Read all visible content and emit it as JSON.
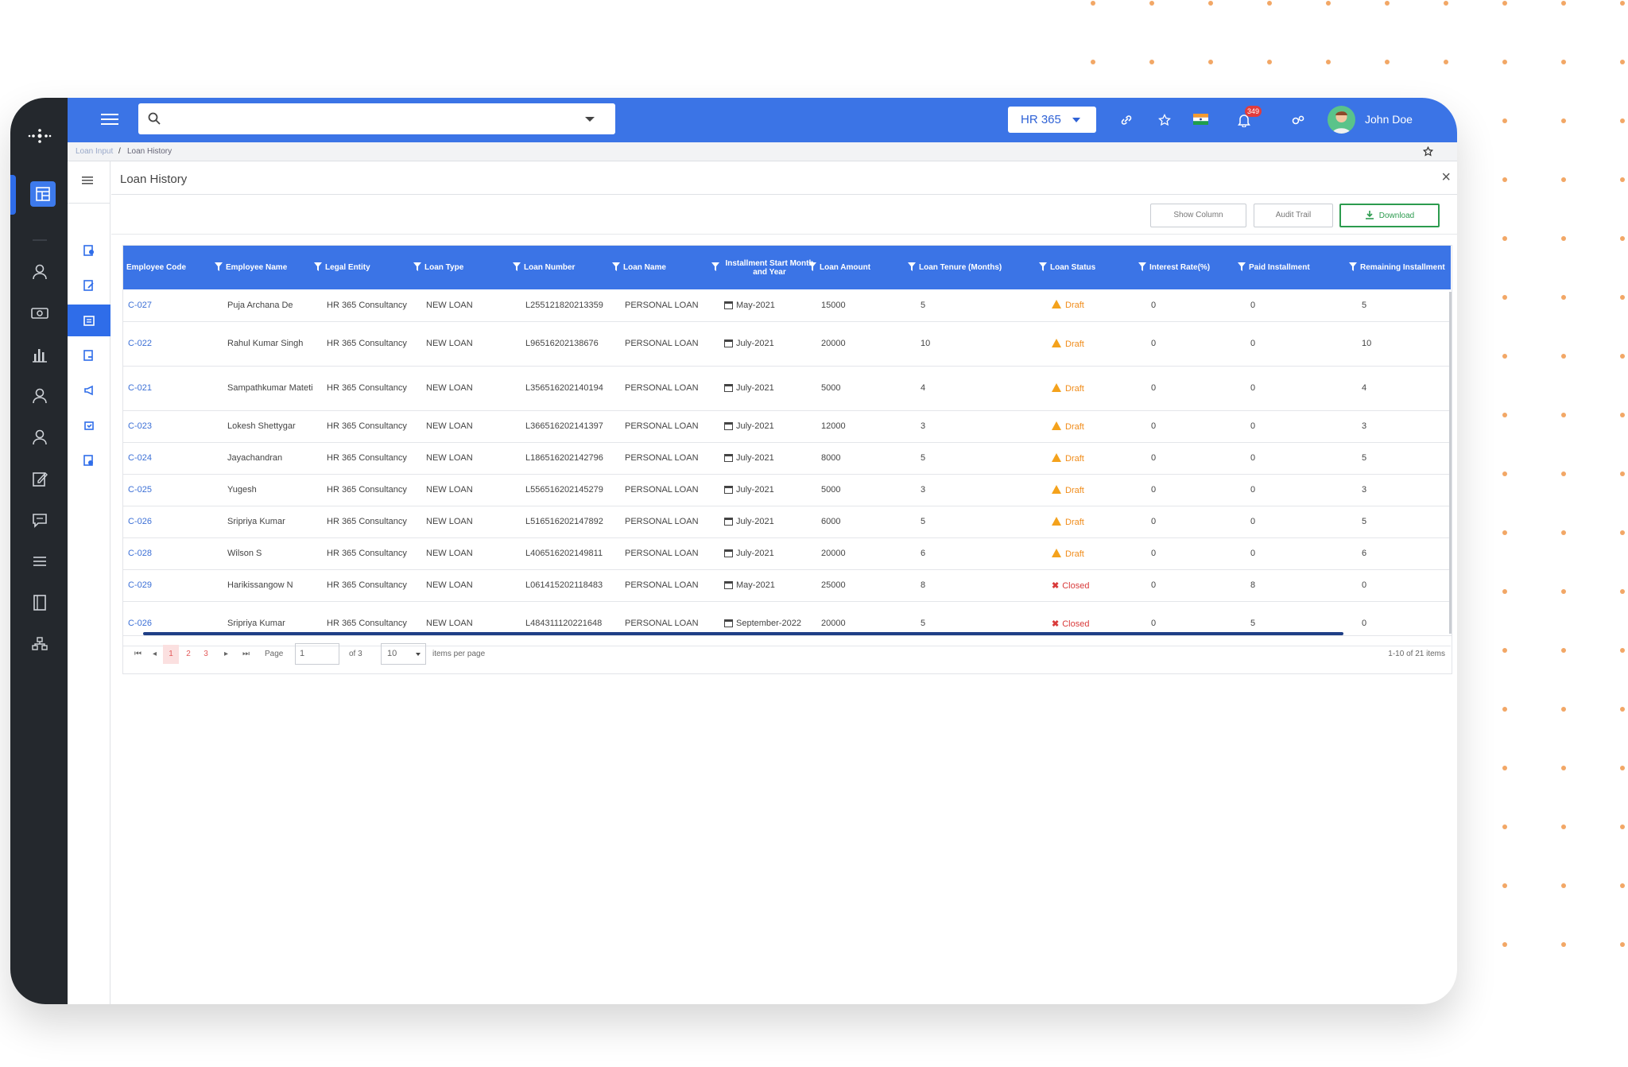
{
  "search": {
    "placeholder": ""
  },
  "header": {
    "module_selector": "HR 365",
    "notification_count": "349",
    "user_name": "John Doe"
  },
  "breadcrumb": {
    "parent": "Loan Input",
    "separator": "/",
    "current": "Loan History"
  },
  "page": {
    "title": "Loan History",
    "close": "×"
  },
  "toolbar": {
    "show_column": "Show Column",
    "audit_trail": "Audit Trail",
    "download": "Download"
  },
  "table": {
    "columns": [
      "Employee Code",
      "Employee Name",
      "Legal Entity",
      "Loan Type",
      "Loan Number",
      "Loan Name",
      "Installment Start Month and Year",
      "Loan Amount",
      "Loan Tenure (Months)",
      "Loan Status",
      "Interest Rate(%)",
      "Paid Installment",
      "Remaining Installment"
    ],
    "rows": [
      {
        "code": "C-027",
        "name": "Puja Archana De",
        "entity": "HR 365 Consultancy",
        "type": "NEW LOAN",
        "number": "L255121820213359",
        "loan_name": "PERSONAL LOAN",
        "start": "May-2021",
        "amount": "15000",
        "tenure": "5",
        "status": "Draft",
        "rate": "0",
        "paid": "0",
        "remaining": "5"
      },
      {
        "code": "C-022",
        "name": "Rahul Kumar Singh",
        "entity": "HR 365 Consultancy",
        "type": "NEW LOAN",
        "number": "L96516202138676",
        "loan_name": "PERSONAL LOAN",
        "start": "July-2021",
        "amount": "20000",
        "tenure": "10",
        "status": "Draft",
        "rate": "0",
        "paid": "0",
        "remaining": "10"
      },
      {
        "code": "C-021",
        "name": "Sampathkumar Mateti",
        "entity": "HR 365 Consultancy",
        "type": "NEW LOAN",
        "number": "L356516202140194",
        "loan_name": "PERSONAL LOAN",
        "start": "July-2021",
        "amount": "5000",
        "tenure": "4",
        "status": "Draft",
        "rate": "0",
        "paid": "0",
        "remaining": "4"
      },
      {
        "code": "C-023",
        "name": "Lokesh Shettygar",
        "entity": "HR 365 Consultancy",
        "type": "NEW LOAN",
        "number": "L366516202141397",
        "loan_name": "PERSONAL LOAN",
        "start": "July-2021",
        "amount": "12000",
        "tenure": "3",
        "status": "Draft",
        "rate": "0",
        "paid": "0",
        "remaining": "3"
      },
      {
        "code": "C-024",
        "name": "Jayachandran",
        "entity": "HR 365 Consultancy",
        "type": "NEW LOAN",
        "number": "L186516202142796",
        "loan_name": "PERSONAL LOAN",
        "start": "July-2021",
        "amount": "8000",
        "tenure": "5",
        "status": "Draft",
        "rate": "0",
        "paid": "0",
        "remaining": "5"
      },
      {
        "code": "C-025",
        "name": "Yugesh",
        "entity": "HR 365 Consultancy",
        "type": "NEW LOAN",
        "number": "L556516202145279",
        "loan_name": "PERSONAL LOAN",
        "start": "July-2021",
        "amount": "5000",
        "tenure": "3",
        "status": "Draft",
        "rate": "0",
        "paid": "0",
        "remaining": "3"
      },
      {
        "code": "C-026",
        "name": "Sripriya Kumar",
        "entity": "HR 365 Consultancy",
        "type": "NEW LOAN",
        "number": "L516516202147892",
        "loan_name": "PERSONAL LOAN",
        "start": "July-2021",
        "amount": "6000",
        "tenure": "5",
        "status": "Draft",
        "rate": "0",
        "paid": "0",
        "remaining": "5"
      },
      {
        "code": "C-028",
        "name": "Wilson S",
        "entity": "HR 365 Consultancy",
        "type": "NEW LOAN",
        "number": "L406516202149811",
        "loan_name": "PERSONAL LOAN",
        "start": "July-2021",
        "amount": "20000",
        "tenure": "6",
        "status": "Draft",
        "rate": "0",
        "paid": "0",
        "remaining": "6"
      },
      {
        "code": "C-029",
        "name": "Harikissangow N",
        "entity": "HR 365 Consultancy",
        "type": "NEW LOAN",
        "number": "L061415202118483",
        "loan_name": "PERSONAL LOAN",
        "start": "May-2021",
        "amount": "25000",
        "tenure": "8",
        "status": "Closed",
        "rate": "0",
        "paid": "8",
        "remaining": "0"
      },
      {
        "code": "C-026",
        "name": "Sripriya Kumar",
        "entity": "HR 365 Consultancy",
        "type": "NEW LOAN",
        "number": "L484311120221648",
        "loan_name": "PERSONAL LOAN",
        "start": "September-2022",
        "amount": "20000",
        "tenure": "5",
        "status": "Closed",
        "rate": "0",
        "paid": "5",
        "remaining": "0"
      }
    ]
  },
  "pager": {
    "pages": [
      "1",
      "2",
      "3"
    ],
    "page_label": "Page",
    "page_value": "1",
    "of_label": "of 3",
    "per_page_value": "10",
    "per_page_label": "items per page",
    "summary": "1-10 of 21 items"
  },
  "colors": {
    "primary": "#3b74e6",
    "rail": "#24282d",
    "draft": "#f08c1a",
    "closed": "#d93b3b",
    "download": "#2c9b4e",
    "dots": "#f2a766"
  }
}
